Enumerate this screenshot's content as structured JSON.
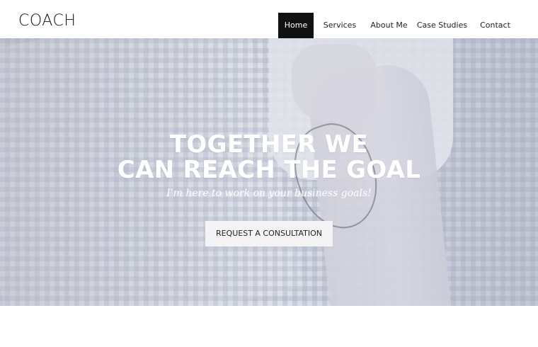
{
  "header": {
    "logo": "COACH",
    "nav": [
      {
        "label": "Home",
        "active": true
      },
      {
        "label": "Services",
        "active": false
      },
      {
        "label": "About Me",
        "active": false
      },
      {
        "label": "Case Studies",
        "active": false
      },
      {
        "label": "Contact",
        "active": false
      }
    ]
  },
  "hero": {
    "title_line1": "TOGETHER WE",
    "title_line2": "CAN REACH THE GOAL",
    "subtitle": "I'm here to work on your business goals!",
    "cta_label": "REQUEST A CONSULTATION"
  },
  "colors": {
    "nav_active_bg": "#111111",
    "cta_bg": "#f4f4f6",
    "hero_text": "#ffffff"
  }
}
